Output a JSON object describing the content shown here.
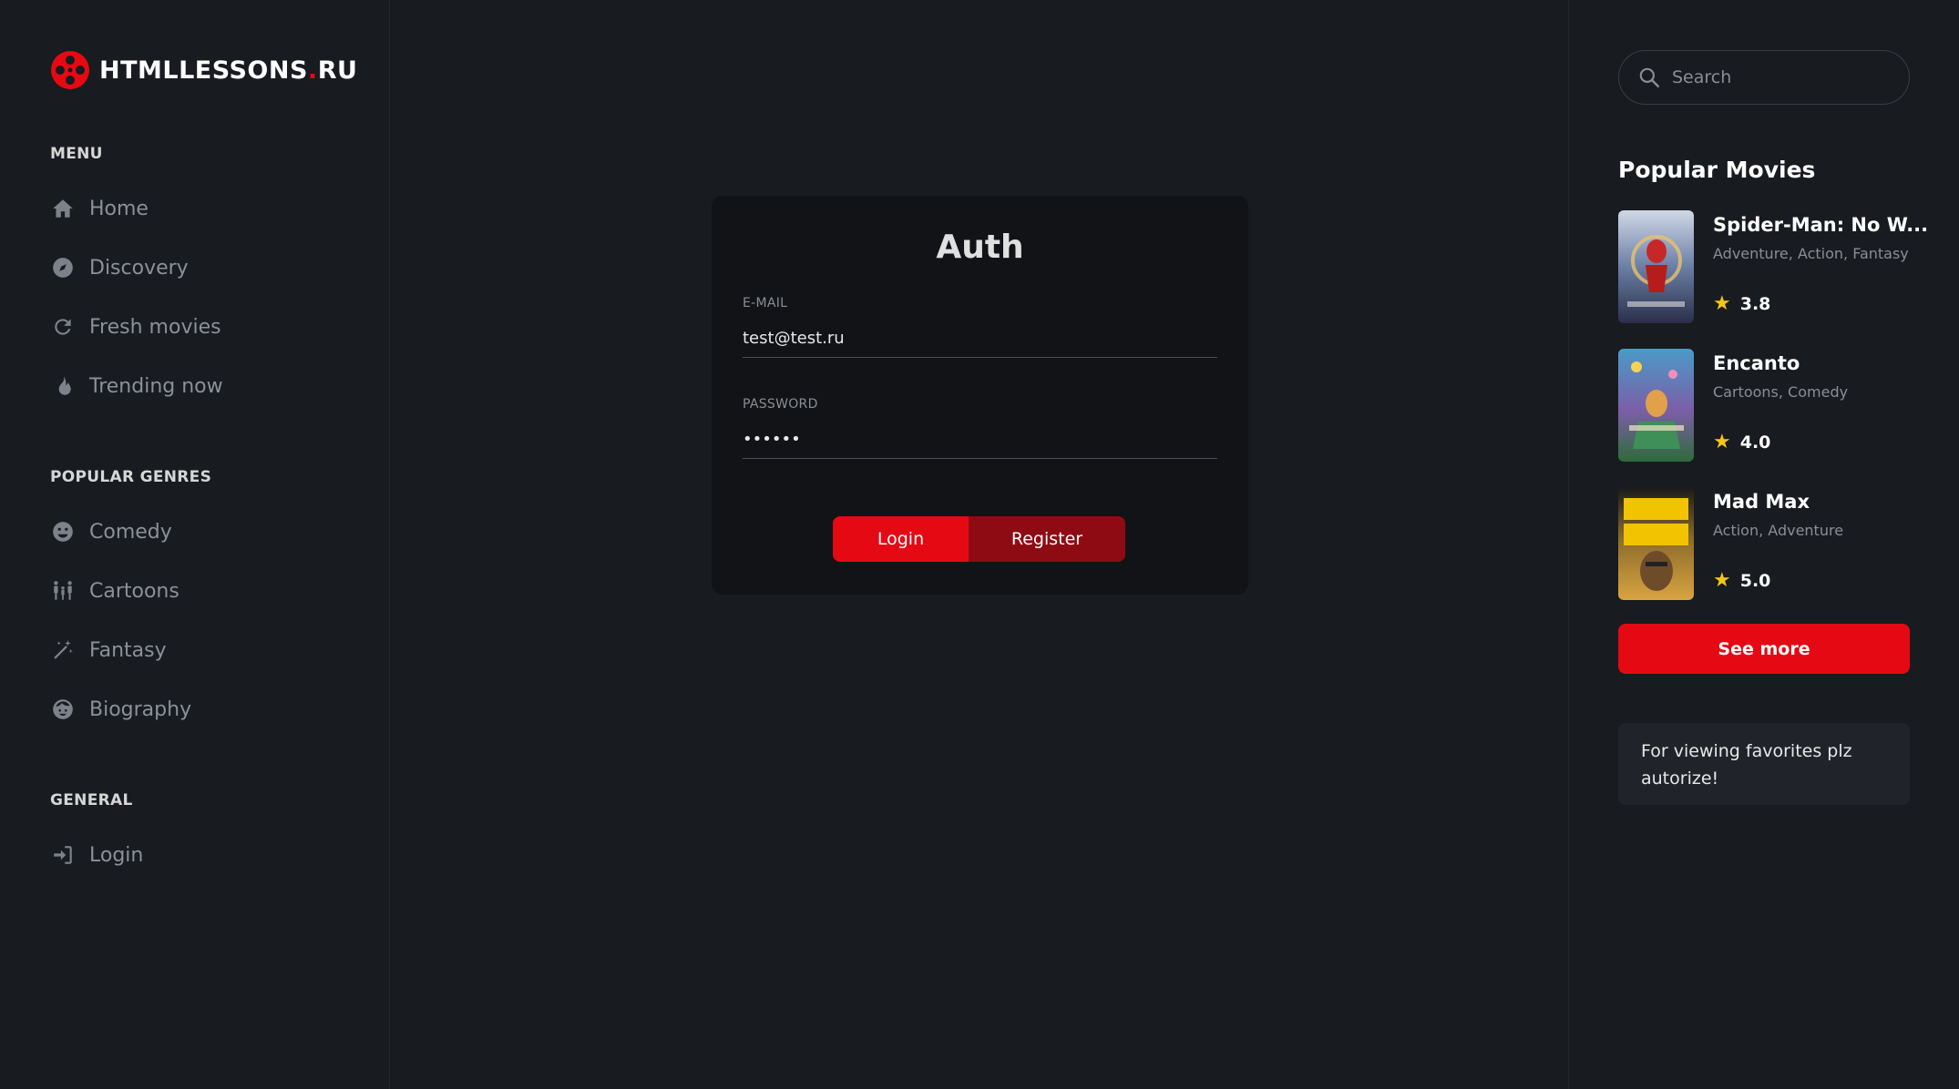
{
  "brand": {
    "name": "HTMLLESSONS",
    "dot": ".",
    "tld": "RU",
    "accent": "#e50914"
  },
  "menu": {
    "title": "MENU",
    "items": [
      {
        "label": "Home",
        "icon": "home-icon"
      },
      {
        "label": "Discovery",
        "icon": "compass-icon"
      },
      {
        "label": "Fresh movies",
        "icon": "refresh-icon"
      },
      {
        "label": "Trending now",
        "icon": "fire-icon"
      }
    ]
  },
  "genres": {
    "title": "POPULAR GENRES",
    "items": [
      {
        "label": "Comedy",
        "icon": "smile-icon"
      },
      {
        "label": "Cartoons",
        "icon": "family-icon"
      },
      {
        "label": "Fantasy",
        "icon": "magic-wand-icon"
      },
      {
        "label": "Biography",
        "icon": "face-icon"
      }
    ]
  },
  "general": {
    "title": "GENERAL",
    "items": [
      {
        "label": "Login",
        "icon": "sign-in-icon"
      }
    ]
  },
  "auth": {
    "title": "Auth",
    "email_label": "E-MAIL",
    "email_value": "test@test.ru",
    "password_label": "PASSWORD",
    "password_value": "••••••",
    "login_label": "Login",
    "register_label": "Register"
  },
  "search": {
    "placeholder": "Search"
  },
  "popular": {
    "title": "Popular Movies",
    "movies": [
      {
        "title": "Spider-Man: No W...",
        "genres": "Adventure, Action, Fantasy",
        "rating": "3.8"
      },
      {
        "title": "Encanto",
        "genres": "Cartoons, Comedy",
        "rating": "4.0"
      },
      {
        "title": "Mad Max",
        "genres": "Action, Adventure",
        "rating": "5.0"
      }
    ],
    "see_more_label": "See more"
  },
  "favorites_note": "For viewing favorites plz autorize!",
  "colors": {
    "accent": "#e50914",
    "accent_dark": "#8f0b13",
    "star": "#f5c518",
    "background": "#181b1f"
  }
}
